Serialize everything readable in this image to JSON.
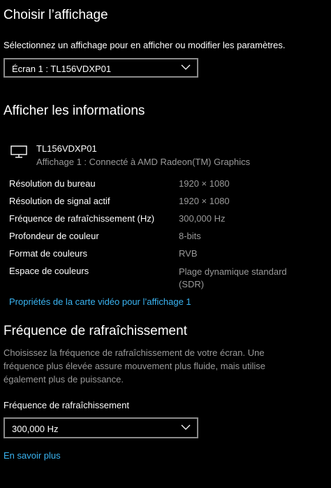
{
  "choose_display": {
    "title": "Choisir l’affichage",
    "description": "Sélectionnez un affichage pour en afficher ou modifier les paramètres.",
    "selected_display": "Écran 1 : TL156VDXP01"
  },
  "display_info": {
    "title": "Afficher les informations",
    "monitor_name": "TL156VDXP01",
    "monitor_subtitle": "Affichage 1 : Connecté à AMD Radeon(TM) Graphics",
    "rows": [
      {
        "label": "Résolution du bureau",
        "value": "1920 × 1080"
      },
      {
        "label": "Résolution de signal actif",
        "value": "1920 × 1080"
      },
      {
        "label": "Fréquence de rafraîchissement (Hz)",
        "value": "300,000 Hz"
      },
      {
        "label": "Profondeur de couleur",
        "value": "8-bits"
      },
      {
        "label": "Format de couleurs",
        "value": "RVB"
      },
      {
        "label": "Espace de couleurs",
        "value": "Plage dynamique standard",
        "value_line2": "(SDR)"
      }
    ],
    "adapter_link": "Propriétés de la carte vidéo pour l’affichage 1"
  },
  "refresh_rate": {
    "title": "Fréquence de rafraîchissement",
    "description_lines": [
      "Choisissez la fréquence de rafraîchissement de votre écran. Une",
      "fréquence plus élevée assure mouvement plus fluide, mais utilise",
      "également plus de puissance."
    ],
    "field_label": "Fréquence de rafraîchissement",
    "selected_rate": "300,000 Hz",
    "learn_more_link": "En savoir plus"
  },
  "icons": {
    "monitor": "monitor-icon",
    "dropdown": "chevron-down-icon"
  },
  "colors": {
    "background": "#000000",
    "text": "#ffffff",
    "muted": "#9a9a9a",
    "link": "#3ab4f2",
    "border": "#8a8a8a"
  }
}
